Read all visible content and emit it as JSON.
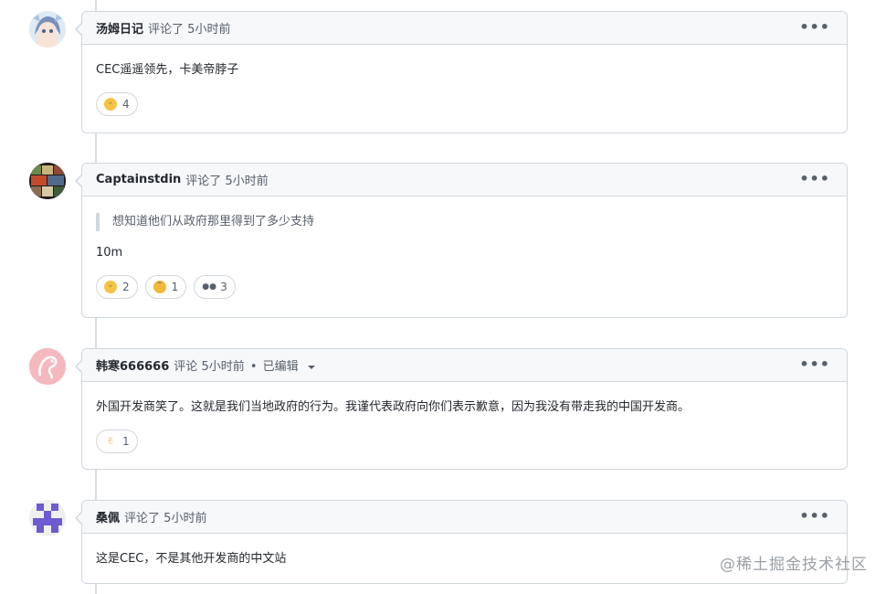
{
  "comments": [
    {
      "author": "汤姆日记",
      "action": "评论了",
      "time": "5小时前",
      "edited": "",
      "avatar_icon": "anime-avatar-icon",
      "quote": "",
      "text": "CEC遥遥领先，卡美帝脖子",
      "reactions": [
        {
          "icon": "laugh-emoji-icon",
          "count": "4"
        }
      ]
    },
    {
      "author": "Captainstdin",
      "action": "评论了",
      "time": "5小时前",
      "edited": "",
      "avatar_icon": "game-cover-avatar-icon",
      "quote": "想知道他们从政府那里得到了多少支持",
      "text": "10m",
      "reactions": [
        {
          "icon": "laugh-emoji-icon",
          "count": "2"
        },
        {
          "icon": "confused-emoji-icon",
          "count": "1"
        },
        {
          "icon": "eyes-emoji-icon",
          "count": "3"
        }
      ]
    },
    {
      "author": "韩寒666666",
      "action": "评论",
      "time": "5小时前",
      "edited": "已编辑",
      "avatar_icon": "sketch-avatar-icon",
      "quote": "",
      "text": "外国开发商笑了。这就是我们当地政府的行为。我谨代表政府向你们表示歉意，因为我没有带走我的中国开发商。",
      "reactions": [
        {
          "icon": "thumbs-up-emoji-icon",
          "count": "1"
        }
      ]
    },
    {
      "author": "桑佩",
      "action": "评论了",
      "time": "5小时前",
      "edited": "",
      "avatar_icon": "identicon-avatar-icon",
      "quote": "",
      "text": "这是CEC，不是其他开发商的中文站",
      "reactions": []
    }
  ],
  "more_icon": "kebab-menu-icon",
  "watermark": "@稀土掘金技术社区",
  "colors": {
    "border": "#d0d7de",
    "header_bg": "#f6f8fa",
    "muted": "#57606a",
    "identicon": "#6e5bd0"
  }
}
